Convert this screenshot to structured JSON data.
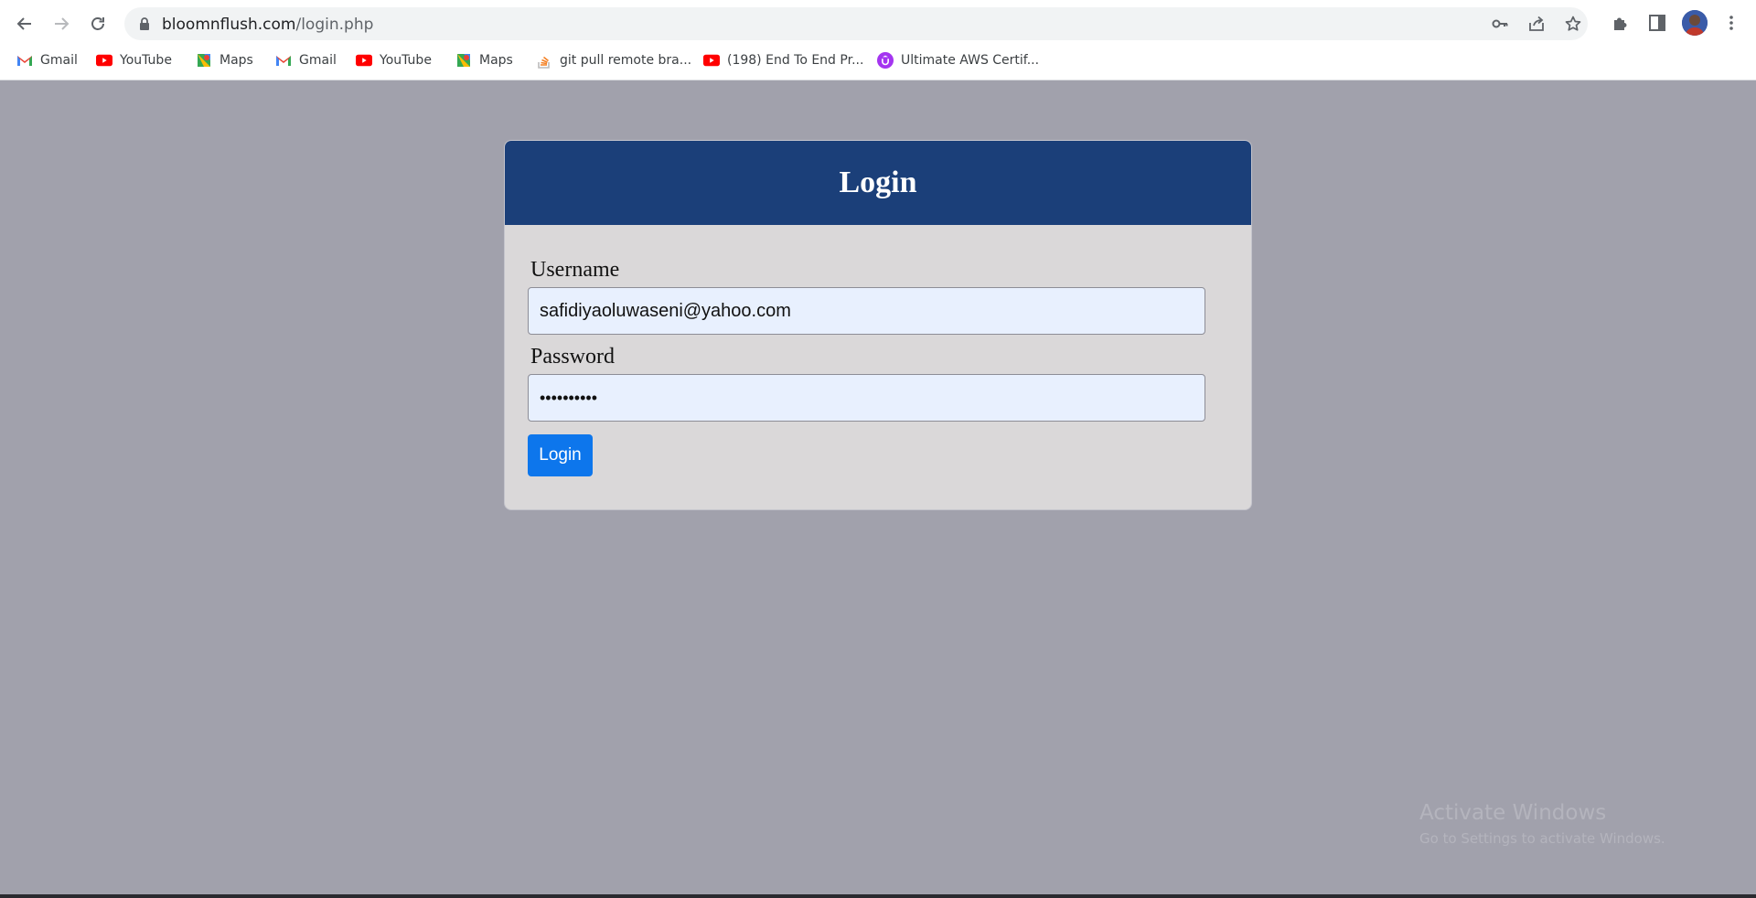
{
  "browser": {
    "url_host": "bloomnflush.com",
    "url_path": "/login.php",
    "icons": [
      "back-icon",
      "forward-icon",
      "reload-icon",
      "lock-icon",
      "key-icon",
      "share-icon",
      "star-icon",
      "extensions-icon",
      "side-panel-icon",
      "kebab-menu-icon"
    ]
  },
  "bookmarks": [
    {
      "label": "Gmail",
      "icon": "gmail-icon"
    },
    {
      "label": "YouTube",
      "icon": "youtube-icon"
    },
    {
      "label": "Maps",
      "icon": "maps-icon"
    },
    {
      "label": "Gmail",
      "icon": "gmail-icon"
    },
    {
      "label": "YouTube",
      "icon": "youtube-icon"
    },
    {
      "label": "Maps",
      "icon": "maps-icon"
    },
    {
      "label": "git pull remote bra...",
      "icon": "stackoverflow-icon"
    },
    {
      "label": "(198) End To End Pr...",
      "icon": "youtube-icon"
    },
    {
      "label": "Ultimate AWS Certif...",
      "icon": "udemy-icon"
    }
  ],
  "login": {
    "title": "Login",
    "username_label": "Username",
    "username_value": "safidiyaoluwaseni@yahoo.com",
    "password_label": "Password",
    "password_value": "••••••••••",
    "submit_label": "Login"
  },
  "watermark": {
    "title": "Activate Windows",
    "subtitle": "Go to Settings to activate Windows."
  },
  "colors": {
    "page_background": "#a1a1ac",
    "header": "#1b3f79",
    "card": "#dad8d9",
    "button": "#0d76ec",
    "input": "#e8f0fe"
  }
}
